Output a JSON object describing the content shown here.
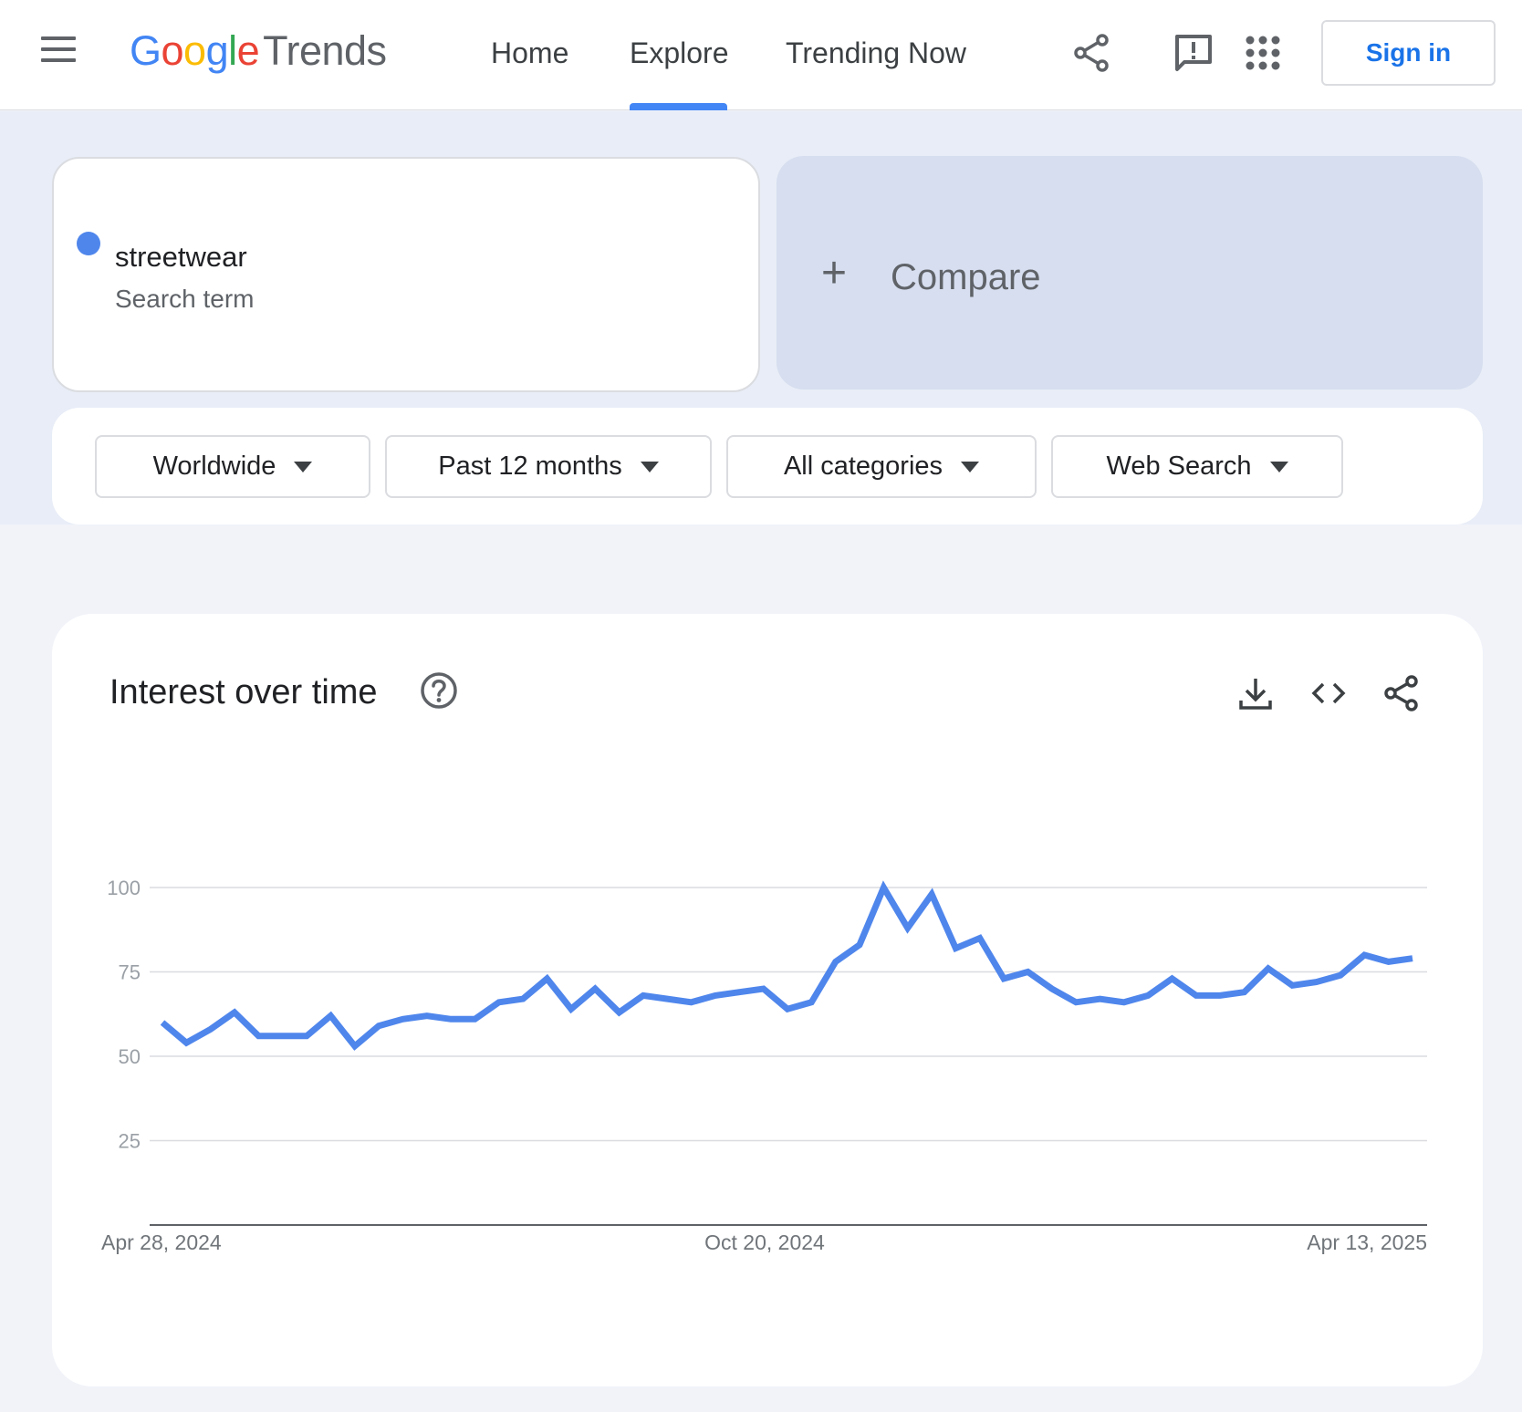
{
  "header": {
    "logo": {
      "google": [
        "G",
        "o",
        "o",
        "g",
        "l",
        "e"
      ],
      "product": "Trends"
    },
    "nav": [
      {
        "label": "Home",
        "active": false
      },
      {
        "label": "Explore",
        "active": true
      },
      {
        "label": "Trending Now",
        "active": false
      }
    ],
    "icons": [
      "share-icon",
      "feedback-icon",
      "apps-icon"
    ],
    "sign_in": "Sign in",
    "accent_color": "#4285f4"
  },
  "search": {
    "term": "streetwear",
    "term_type": "Search term",
    "term_color": "#4f86ec",
    "compare_label": "Compare"
  },
  "filters": [
    {
      "label": "Worldwide"
    },
    {
      "label": "Past 12 months"
    },
    {
      "label": "All categories"
    },
    {
      "label": "Web Search"
    }
  ],
  "chart": {
    "title": "Interest over time",
    "icons": [
      "help-icon",
      "download-icon",
      "embed-icon",
      "share-icon"
    ]
  },
  "chart_data": {
    "type": "line",
    "title": "Interest over time",
    "xlabel": "",
    "ylabel": "",
    "ylim": [
      0,
      100
    ],
    "yticks": [
      100,
      75,
      50,
      25
    ],
    "x_tick_labels": [
      "Apr 28, 2024",
      "Oct 20, 2024",
      "Apr 13, 2025"
    ],
    "grid": true,
    "series": [
      {
        "name": "streetwear",
        "color": "#4f86ec",
        "values": [
          60,
          54,
          58,
          63,
          56,
          56,
          56,
          62,
          53,
          59,
          61,
          62,
          61,
          61,
          66,
          67,
          73,
          64,
          70,
          63,
          68,
          67,
          66,
          68,
          69,
          70,
          64,
          66,
          78,
          83,
          100,
          88,
          98,
          82,
          85,
          73,
          75,
          70,
          66,
          67,
          66,
          68,
          73,
          68,
          68,
          69,
          76,
          71,
          72,
          74,
          80,
          78,
          79
        ]
      }
    ]
  }
}
